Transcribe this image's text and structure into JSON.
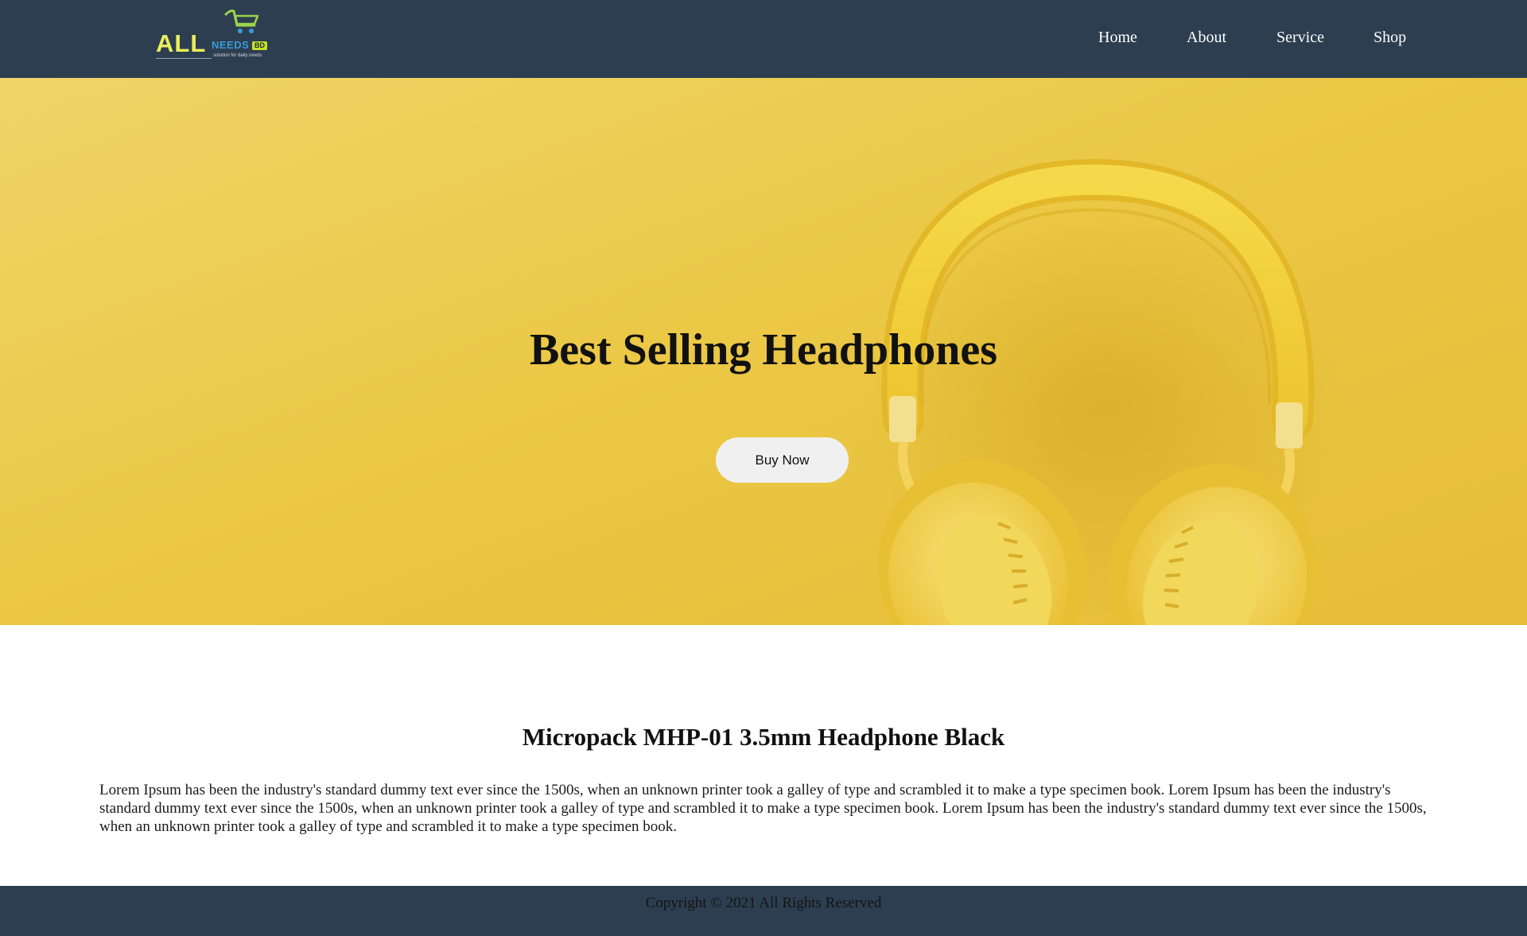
{
  "header": {
    "logo": {
      "brand": "ALL",
      "sub": "NEEDS",
      "badge": "BD",
      "tagline": "solution for daily needs",
      "icon": "shopping-cart-icon"
    },
    "nav": [
      {
        "label": "Home"
      },
      {
        "label": "About"
      },
      {
        "label": "Service"
      },
      {
        "label": "Shop"
      }
    ]
  },
  "hero": {
    "title": "Best Selling Headphones",
    "button_label": "Buy Now",
    "image": "yellow-headphones-image"
  },
  "product": {
    "title": "Micropack MHP-01 3.5mm Headphone Black",
    "description": "Lorem Ipsum has been the industry's standard dummy text ever since the 1500s, when an unknown printer took a galley of type and scrambled it to make a type specimen book. Lorem Ipsum has been the industry's standard dummy text ever since the 1500s, when an unknown printer took a galley of type and scrambled it to make a type specimen book. Lorem Ipsum has been the industry's standard dummy text ever since the 1500s, when an unknown printer took a galley of type and scrambled it to make a type specimen book."
  },
  "footer": {
    "copyright": "Copyright © 2021 All Rights Reserved"
  },
  "colors": {
    "header_bg": "#2d3e50",
    "hero_bg": "#ebc846",
    "button_bg": "#f0f0f0",
    "logo_accent": "#e9ef5c"
  }
}
